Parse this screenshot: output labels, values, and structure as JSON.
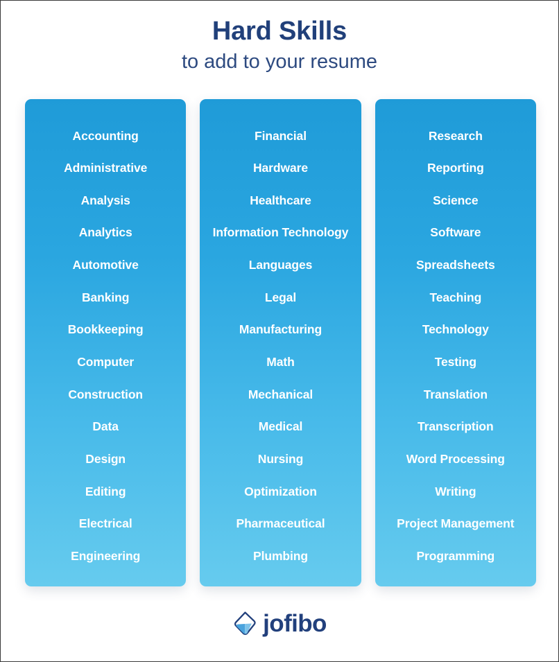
{
  "header": {
    "title": "Hard Skills",
    "subtitle": "to add to your resume"
  },
  "colors": {
    "title": "#21407a",
    "subtitle": "#2d4a80",
    "card_gradient_top": "#1f9bd8",
    "card_gradient_bottom": "#66cbee",
    "skill_text": "#ffffff",
    "logo_text": "#22407c",
    "logo_mark_outline": "#22407c",
    "logo_mark_fill": "#4aa3dd",
    "page_background": "#ffffff"
  },
  "columns": [
    {
      "id": "column-1",
      "skills": [
        "Accounting",
        "Administrative",
        "Analysis",
        "Analytics",
        "Automotive",
        "Banking",
        "Bookkeeping",
        "Computer",
        "Construction",
        "Data",
        "Design",
        "Editing",
        "Electrical",
        "Engineering"
      ]
    },
    {
      "id": "column-2",
      "skills": [
        "Financial",
        "Hardware",
        "Healthcare",
        "Information Technology",
        "Languages",
        "Legal",
        "Manufacturing",
        "Math",
        "Mechanical",
        "Medical",
        "Nursing",
        "Optimization",
        "Pharmaceutical",
        "Plumbing"
      ]
    },
    {
      "id": "column-3",
      "skills": [
        "Research",
        "Reporting",
        "Science",
        "Software",
        "Spreadsheets",
        "Teaching",
        "Technology",
        "Testing",
        "Translation",
        "Transcription",
        "Word Processing",
        "Writing",
        "Project Management",
        "Programming"
      ]
    }
  ],
  "footer": {
    "logo_icon": "jofibo-diamond-icon",
    "logo_text": "jofibo"
  }
}
